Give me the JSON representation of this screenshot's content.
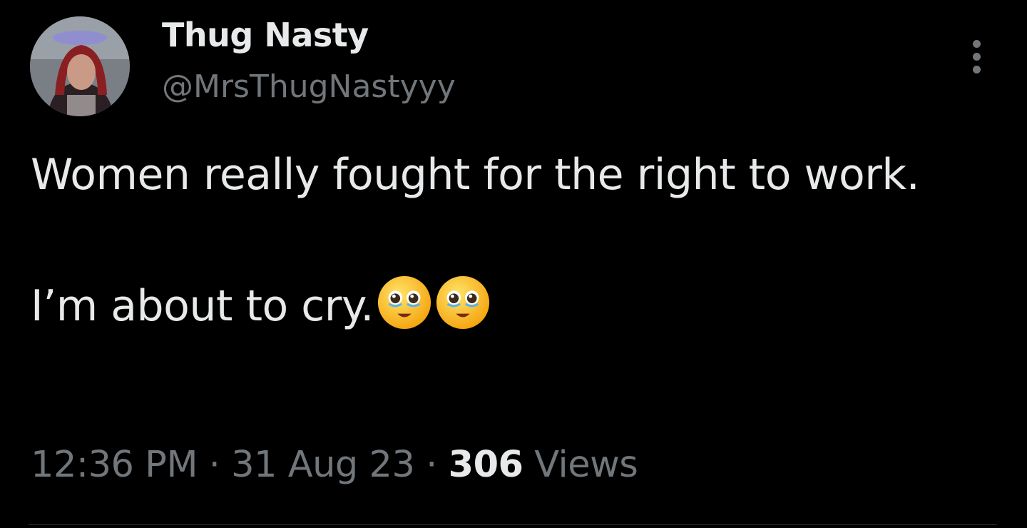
{
  "author": {
    "name": "Thug Nasty",
    "handle": "@MrsThugNastyyy"
  },
  "tweet": {
    "line1": "Women really fought for the right to work.",
    "line2": "I’m about to cry.",
    "emojis": [
      "face-holding-back-tears",
      "face-holding-back-tears"
    ]
  },
  "meta": {
    "time": "12:36 PM",
    "separator": "·",
    "date": "31 Aug 23",
    "views_count": "306",
    "views_label": "Views"
  },
  "colors": {
    "background": "#000000",
    "primary_text": "#e7e9ea",
    "secondary_text": "#71767b",
    "divider": "#2f3336"
  },
  "icons": {
    "more": "more-vertical-icon"
  }
}
